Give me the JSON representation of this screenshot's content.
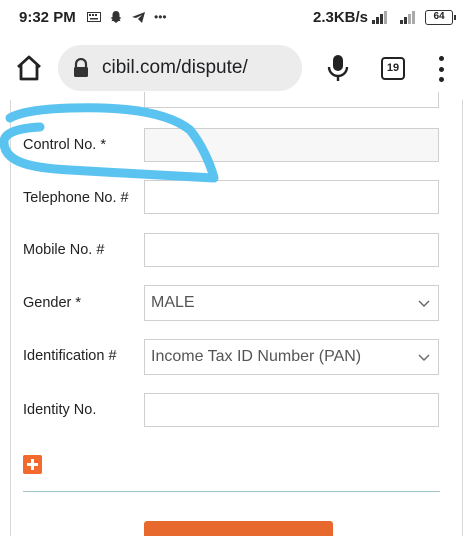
{
  "status_bar": {
    "time": "9:32 PM",
    "notification_icons": [
      "keyboard-icon",
      "snapchat-icon",
      "telegram-icon",
      "more-notifications-icon"
    ],
    "network_speed": "2.3KB/s",
    "battery": "64"
  },
  "browser": {
    "url": "cibil.com/dispute/",
    "tab_count": "19"
  },
  "form": {
    "control_no_label": "Control No. *",
    "telephone_label": "Telephone No. #",
    "mobile_label": "Mobile No. #",
    "gender_label": "Gender *",
    "gender_value": "MALE",
    "identification_label": "Identification #",
    "identification_value": "Income Tax ID Number (PAN)",
    "identity_no_label": "Identity No."
  },
  "colors": {
    "annotation": "#5bc3ef",
    "accent": "#f26a2e",
    "submit": "#e8692e",
    "divider": "#9fc6c9"
  }
}
